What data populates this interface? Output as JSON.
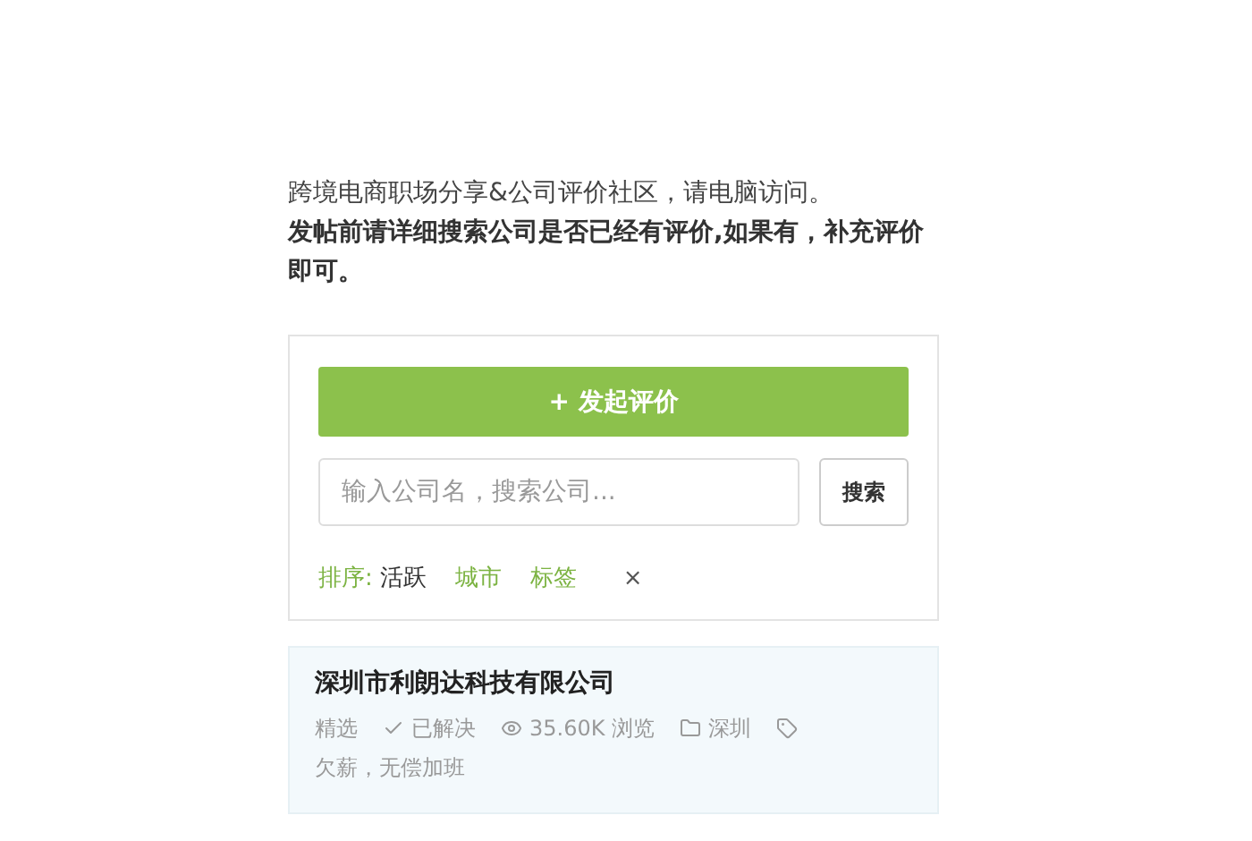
{
  "intro": {
    "line": "跨境电商职场分享&公司评价社区，请电脑访问。",
    "notice": "发帖前请详细搜索公司是否已经有评价,如果有，补充评价即可。"
  },
  "panel": {
    "create_button": "+ 发起评价",
    "search": {
      "placeholder": "输入公司名，搜索公司...",
      "button": "搜索"
    },
    "sort": {
      "label": "排序:",
      "options": [
        {
          "label": "活跃",
          "selected": true
        },
        {
          "label": "城市",
          "selected": false
        },
        {
          "label": "标签",
          "selected": false
        }
      ],
      "clear": "×"
    }
  },
  "companies": [
    {
      "name": "深圳市利朗达科技有限公司",
      "meta": [
        {
          "kind": "badge",
          "text": "精选"
        },
        {
          "kind": "status",
          "text": "已解决"
        },
        {
          "kind": "views",
          "text": "35.60K 浏览"
        },
        {
          "kind": "city",
          "text": "深圳"
        },
        {
          "kind": "tags",
          "text": "欠薪，无偿加班"
        }
      ]
    }
  ]
}
